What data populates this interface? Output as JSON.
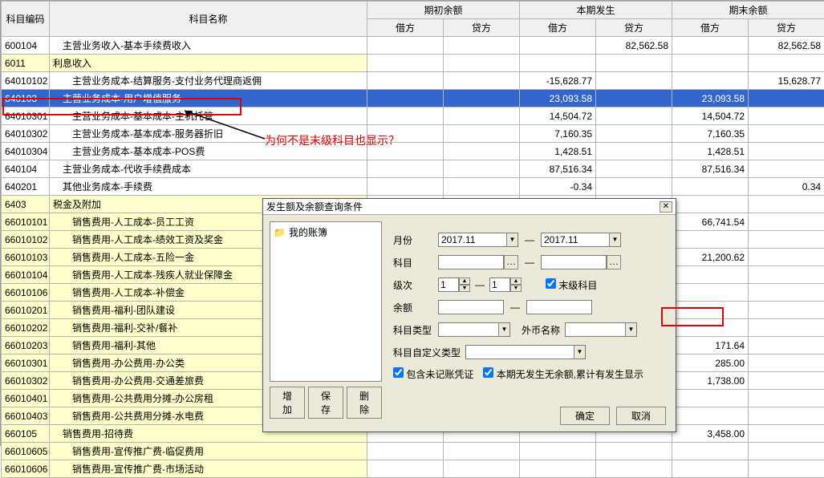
{
  "headers": {
    "code": "科目编码",
    "name": "科目名称",
    "opening": "期初余额",
    "current": "本期发生",
    "ending": "期末余额",
    "debit": "借方",
    "credit": "贷方"
  },
  "rows": [
    {
      "code": "600104",
      "name": "　主营业务收入-基本手续费收入",
      "bg": "w",
      "c4": "82,562.58",
      "c6": "82,562.58"
    },
    {
      "code": "6011",
      "name": "利息收入",
      "bg": "y"
    },
    {
      "code": "64010102",
      "name": "　　主营业务成本-结算服务-支付业务代理商返佣",
      "bg": "w",
      "c3": "-15,628.77",
      "c6": "15,628.77"
    },
    {
      "code": "640103",
      "name": "　主营业务成本-用户增值服务",
      "bg": "w",
      "c3": "23,093.58",
      "c5": "23,093.58",
      "sel": true
    },
    {
      "code": "64010301",
      "name": "　　主营业务成本-基本成本-主机托管",
      "bg": "w",
      "c3": "14,504.72",
      "c5": "14,504.72"
    },
    {
      "code": "64010302",
      "name": "　　主营业务成本-基本成本-服务器折旧",
      "bg": "w",
      "c3": "7,160.35",
      "c5": "7,160.35"
    },
    {
      "code": "64010304",
      "name": "　　主营业务成本-基本成本-POS费",
      "bg": "w",
      "c3": "1,428.51",
      "c5": "1,428.51"
    },
    {
      "code": "640104",
      "name": "　主营业务成本-代收手续费成本",
      "bg": "w",
      "c3": "87,516.34",
      "c5": "87,516.34"
    },
    {
      "code": "640201",
      "name": "　其他业务成本-手续费",
      "bg": "w",
      "c3": "-0.34",
      "c6": "0.34"
    },
    {
      "code": "6403",
      "name": "税金及附加",
      "bg": "y"
    },
    {
      "code": "66010101",
      "name": "　　销售费用-人工成本-员工工资",
      "bg": "y",
      "c5": "66,741.54"
    },
    {
      "code": "66010102",
      "name": "　　销售费用-人工成本-绩效工资及奖金",
      "bg": "y"
    },
    {
      "code": "66010103",
      "name": "　　销售费用-人工成本-五险一金",
      "bg": "y",
      "c5": "21,200.62"
    },
    {
      "code": "66010104",
      "name": "　　销售费用-人工成本-残疾人就业保障金",
      "bg": "y"
    },
    {
      "code": "66010106",
      "name": "　　销售费用-人工成本-补偿金",
      "bg": "y"
    },
    {
      "code": "66010201",
      "name": "　　销售费用-福利-团队建设",
      "bg": "y"
    },
    {
      "code": "66010202",
      "name": "　　销售费用-福利-交补/餐补",
      "bg": "y"
    },
    {
      "code": "66010203",
      "name": "　　销售费用-福利-其他",
      "bg": "y",
      "c5": "171.64"
    },
    {
      "code": "66010301",
      "name": "　　销售费用-办公费用-办公类",
      "bg": "y",
      "c5": "285.00"
    },
    {
      "code": "66010302",
      "name": "　　销售费用-办公费用-交通差旅费",
      "bg": "y",
      "c5": "1,738.00"
    },
    {
      "code": "66010401",
      "name": "　　销售费用-公共费用分摊-办公房租",
      "bg": "y"
    },
    {
      "code": "66010403",
      "name": "　　销售费用-公共费用分摊-水电费",
      "bg": "y"
    },
    {
      "code": "660105",
      "name": "　销售费用-招待费",
      "bg": "y",
      "c5": "3,458.00"
    },
    {
      "code": "66010605",
      "name": "　　销售费用-宣传推广费-临促费用",
      "bg": "y"
    },
    {
      "code": "66010606",
      "name": "　　销售费用-宣传推广费-市场活动",
      "bg": "y"
    }
  ],
  "annotation": "为何不是末级科目也显示？",
  "dialog": {
    "title": "发生额及余额查询条件",
    "tree_root": "我的账簿",
    "buttons": {
      "add": "增加",
      "save": "保存",
      "del": "删除"
    },
    "labels": {
      "month": "月份",
      "subject": "科目",
      "level": "级次",
      "leaf": "末级科目",
      "balance": "余额",
      "subject_type": "科目类型",
      "currency_name": "外币名称",
      "subject_custom_type": "科目自定义类型",
      "include_unposted": "包含未记账凭证",
      "no_current_no_balance": "本期无发生无余额,累计有发生显示",
      "ok": "确定",
      "cancel": "取消"
    },
    "month_from": "2017.11",
    "month_to": "2017.11",
    "level_from": "1",
    "level_to": "1"
  }
}
